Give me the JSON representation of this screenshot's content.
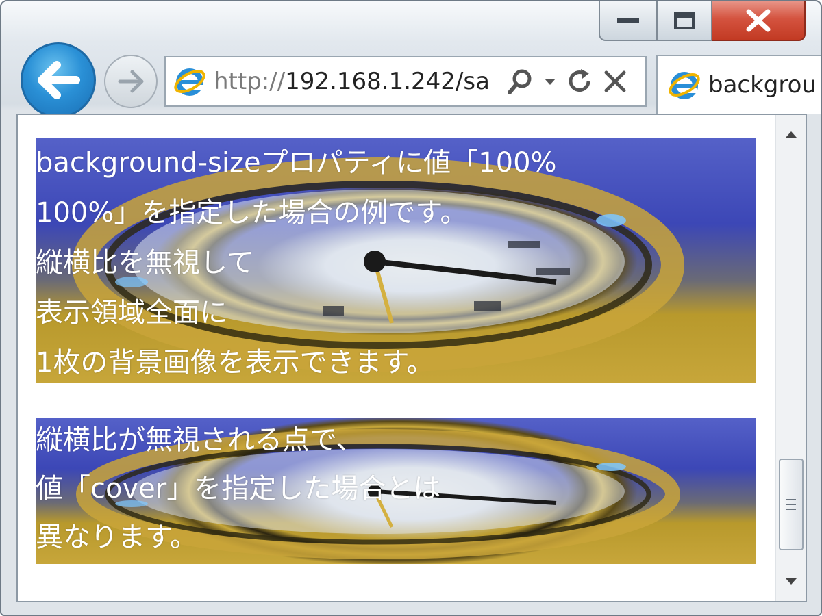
{
  "browser": {
    "address_url_scheme": "http://",
    "address_url_host": "192.168.1.242/sa",
    "tab_title": "backgrou",
    "icons": [
      "back-arrow-icon",
      "forward-arrow-icon",
      "ie-logo-icon",
      "search-icon",
      "dropdown-icon",
      "refresh-icon",
      "stop-icon",
      "minimize-icon",
      "maximize-icon",
      "close-icon"
    ]
  },
  "content": {
    "box1_lines": [
      "background-sizeプロパティに値「100%",
      "100%」を指定した場合の例です。",
      "縦横比を無視して",
      "表示領域全面に",
      "1枚の背景画像を表示できます。"
    ],
    "box2_lines": [
      "縦横比が無視される点で、",
      "値「cover」を指定した場合とは",
      "異なります。"
    ]
  },
  "colors": {
    "accent_back_button": "#2a90d6",
    "close_button": "#c23a23",
    "text_on_image": "#ffffff"
  }
}
